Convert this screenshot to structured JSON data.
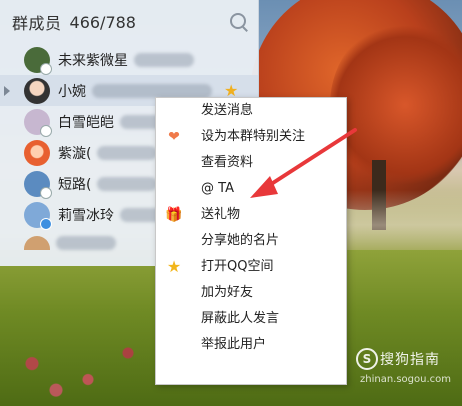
{
  "panel": {
    "title": "群成员",
    "count": "466/788",
    "members": [
      {
        "name": "未来紫微星",
        "avatar_color": "#4a6b3a"
      },
      {
        "name": "小婉",
        "avatar_color": "#e8c0a8"
      },
      {
        "name": "白雪皑皑",
        "avatar_color": "#c7b7d0"
      },
      {
        "name": "紫漩(",
        "avatar_color": "#f0a060"
      },
      {
        "name": "短路(",
        "avatar_color": "#5b8bc0"
      },
      {
        "name": "莉雪冰玲",
        "avatar_color": "#7fa9d8"
      }
    ]
  },
  "context_menu": {
    "items": [
      {
        "label": "发送消息",
        "icon": ""
      },
      {
        "label": "设为本群特别关注",
        "icon": "heart-icon"
      },
      {
        "label": "查看资料",
        "icon": ""
      },
      {
        "label": "@ TA",
        "icon": ""
      },
      {
        "label": "送礼物",
        "icon": "gift-icon"
      },
      {
        "label": "分享她的名片",
        "icon": ""
      },
      {
        "label": "打开QQ空间",
        "icon": "star-icon"
      },
      {
        "label": "加为好友",
        "icon": ""
      },
      {
        "label": "屏蔽此人发言",
        "icon": ""
      },
      {
        "label": "举报此用户",
        "icon": ""
      }
    ]
  },
  "watermark": {
    "logo": "S",
    "text": "搜狗指南",
    "url": "zhinan.sogou.com"
  },
  "colors": {
    "menu_bg": "#ffffff",
    "panel_bg": "#e9eef4",
    "selected_row": "#d6dfea",
    "annotation_arrow": "#e8383a"
  }
}
